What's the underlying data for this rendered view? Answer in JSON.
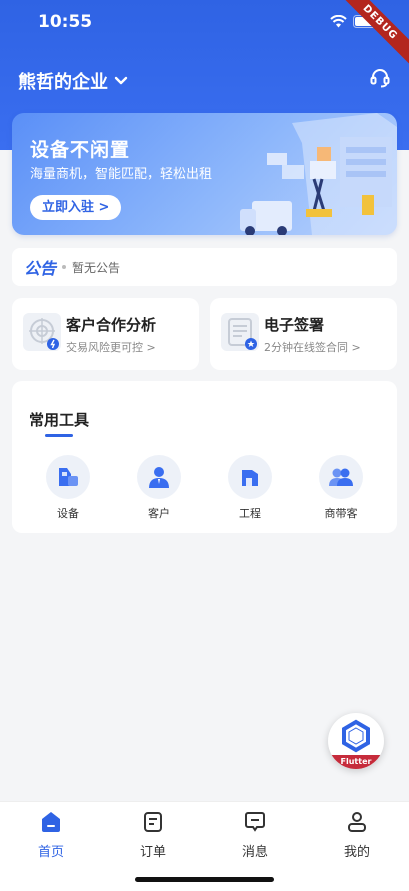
{
  "status_bar": {
    "time": "10:55",
    "debug_label": "DEBUG"
  },
  "header": {
    "company_name": "熊哲的企业"
  },
  "banner": {
    "title": "设备不闲置",
    "subtitle": "海量商机，智能匹配，轻松出租",
    "button_label": "立即入驻 >"
  },
  "notice": {
    "logo_text": "公告",
    "text": "暂无公告"
  },
  "cards": [
    {
      "title": "客户合作分析",
      "subtitle": "交易风险更可控 >"
    },
    {
      "title": "电子签署",
      "subtitle": "2分钟在线签合同 >"
    }
  ],
  "tools": {
    "title": "常用工具",
    "items": [
      {
        "label": "设备",
        "icon": "equipment-icon"
      },
      {
        "label": "客户",
        "icon": "customer-icon"
      },
      {
        "label": "工程",
        "icon": "project-icon"
      },
      {
        "label": "商带客",
        "icon": "merchant-referral-icon"
      }
    ]
  },
  "fab": {
    "label": "Flutter"
  },
  "tabbar": {
    "items": [
      {
        "label": "首页",
        "icon": "home-icon",
        "active": true
      },
      {
        "label": "订单",
        "icon": "order-icon",
        "active": false
      },
      {
        "label": "消息",
        "icon": "message-icon",
        "active": false
      },
      {
        "label": "我的",
        "icon": "profile-icon",
        "active": false
      }
    ]
  },
  "colors": {
    "primary": "#2f63e4",
    "background": "#f4f5f7",
    "flutter_red": "#c62b3b"
  }
}
